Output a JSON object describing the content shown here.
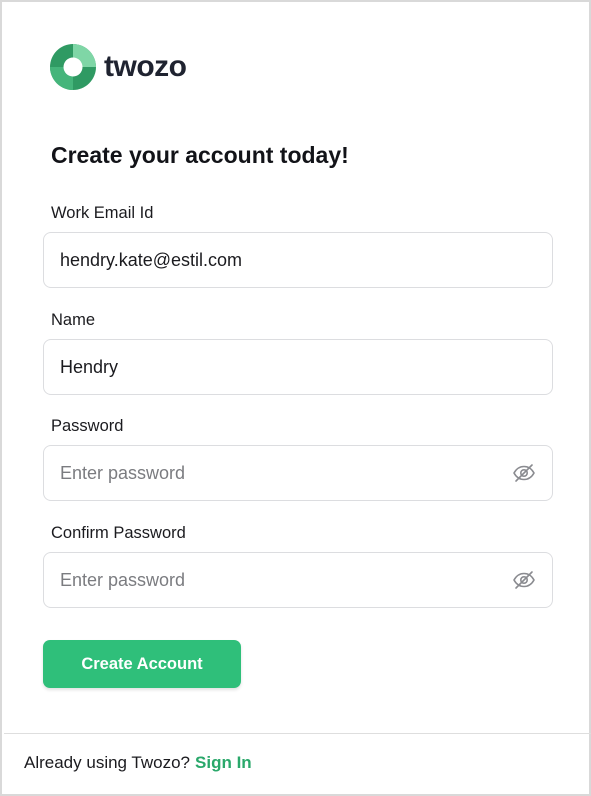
{
  "brand": {
    "name": "twozo",
    "accent_color": "#2fbf7a",
    "logo_icon": "twozo-ring-logo-icon"
  },
  "form": {
    "title": "Create your account today!",
    "email": {
      "label": "Work Email Id",
      "value": "hendry.kate@estil.com"
    },
    "name": {
      "label": "Name",
      "value": "Hendry"
    },
    "password": {
      "label": "Password",
      "placeholder": "Enter password",
      "value": "",
      "toggle_icon": "eye-off-icon"
    },
    "confirm_password": {
      "label": "Confirm Password",
      "placeholder": "Enter password",
      "value": "",
      "toggle_icon": "eye-off-icon"
    },
    "submit_label": "Create Account"
  },
  "footer": {
    "prompt": "Already using Twozo?",
    "link_label": "Sign In",
    "link_color": "#2aa86b"
  }
}
